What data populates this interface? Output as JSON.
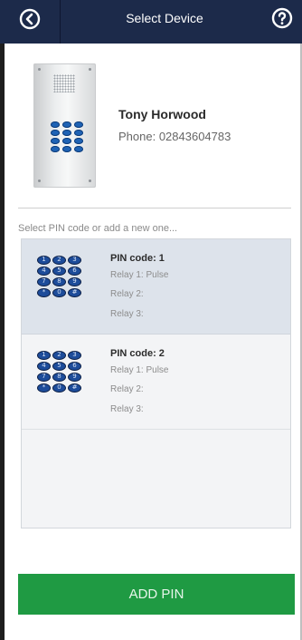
{
  "header": {
    "title": "Select Device",
    "back_icon": "back-arrow-circle-icon",
    "help_icon": "question-circle-icon"
  },
  "device": {
    "name": "Tony Horwood",
    "phone": "Phone: 02843604783",
    "image": "door-entry-panel-icon"
  },
  "pin_list": {
    "prompt": "Select PIN code or add a new one...",
    "items": [
      {
        "title": "PIN code: 1",
        "relay1": "Relay 1: Pulse",
        "relay2": "Relay 2:",
        "relay3": "Relay 3:",
        "selected": true,
        "keypad_icon": "keypad-icon"
      },
      {
        "title": "PIN code: 2",
        "relay1": "Relay 1: Pulse",
        "relay2": "Relay 2:",
        "relay3": "Relay 3:",
        "selected": false,
        "keypad_icon": "keypad-icon"
      }
    ]
  },
  "add_button": {
    "label": "ADD PIN"
  },
  "colors": {
    "header_bg": "#1c2a4a",
    "selected_row_bg": "#dde3eb",
    "add_button_bg": "#1f9a43",
    "keypad_key": "#1d4c9a"
  }
}
